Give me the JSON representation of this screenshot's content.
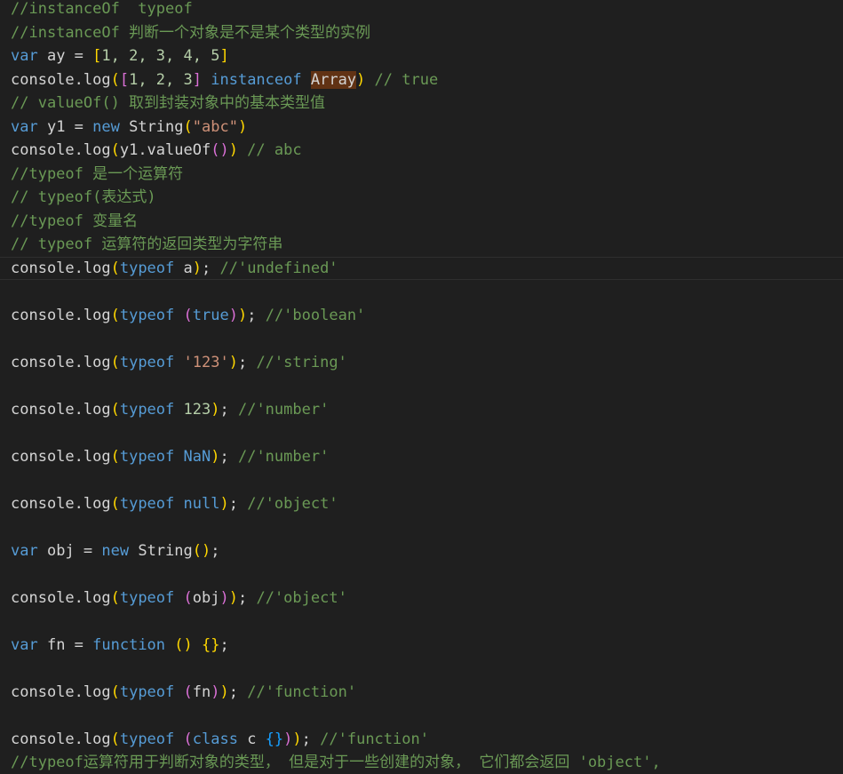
{
  "editor": {
    "colors": {
      "background": "#1f1f1f",
      "comment": "#6a9955",
      "keyword": "#569cd6",
      "string": "#ce9178",
      "number": "#b5cea8",
      "text": "#d4d4d4",
      "bracket_level1": "#ffd700",
      "bracket_level2": "#da70d6",
      "bracket_level3": "#179fff",
      "highlight": "#613214"
    },
    "lines": [
      {
        "tokens": [
          {
            "t": "//instanceOf  typeof",
            "c": "comment"
          }
        ]
      },
      {
        "tokens": [
          {
            "t": "//instanceOf 判断一个对象是不是某个类型的实例",
            "c": "comment"
          }
        ]
      },
      {
        "tokens": [
          {
            "t": "var",
            "c": "kw"
          },
          {
            "t": " ay = ",
            "c": "text"
          },
          {
            "t": "[",
            "c": "b1"
          },
          {
            "t": "1, 2, 3, 4, 5",
            "c": "num"
          },
          {
            "t": "]",
            "c": "b1"
          }
        ]
      },
      {
        "tokens": [
          {
            "t": "console.log",
            "c": "text"
          },
          {
            "t": "(",
            "c": "b1"
          },
          {
            "t": "[",
            "c": "b2"
          },
          {
            "t": "1, 2, 3",
            "c": "num"
          },
          {
            "t": "]",
            "c": "b2"
          },
          {
            "t": " ",
            "c": "text"
          },
          {
            "t": "instanceof",
            "c": "kw"
          },
          {
            "t": " ",
            "c": "text"
          },
          {
            "t": "Array",
            "c": "hl"
          },
          {
            "t": ")",
            "c": "b1"
          },
          {
            "t": " // true",
            "c": "comment"
          }
        ]
      },
      {
        "tokens": [
          {
            "t": "// valueOf() 取到封装对象中的基本类型值",
            "c": "comment"
          }
        ]
      },
      {
        "tokens": [
          {
            "t": "var",
            "c": "kw"
          },
          {
            "t": " y1 = ",
            "c": "text"
          },
          {
            "t": "new",
            "c": "kw"
          },
          {
            "t": " String",
            "c": "text"
          },
          {
            "t": "(",
            "c": "b1"
          },
          {
            "t": "\"abc\"",
            "c": "str"
          },
          {
            "t": ")",
            "c": "b1"
          }
        ]
      },
      {
        "tokens": [
          {
            "t": "console.log",
            "c": "text"
          },
          {
            "t": "(",
            "c": "b1"
          },
          {
            "t": "y1.valueOf",
            "c": "text"
          },
          {
            "t": "()",
            "c": "b2"
          },
          {
            "t": ")",
            "c": "b1"
          },
          {
            "t": " // abc",
            "c": "comment"
          }
        ]
      },
      {
        "tokens": [
          {
            "t": "//typeof 是一个运算符",
            "c": "comment"
          }
        ]
      },
      {
        "tokens": [
          {
            "t": "// typeof(表达式)",
            "c": "comment"
          }
        ]
      },
      {
        "tokens": [
          {
            "t": "//typeof 变量名",
            "c": "comment"
          }
        ]
      },
      {
        "tokens": [
          {
            "t": "// typeof 运算符的返回类型为字符串",
            "c": "comment"
          }
        ]
      },
      {
        "current": true,
        "tokens": [
          {
            "t": "console.log",
            "c": "text"
          },
          {
            "t": "(",
            "c": "b1"
          },
          {
            "t": "typeof",
            "c": "kw"
          },
          {
            "t": " a",
            "c": "text"
          },
          {
            "t": ")",
            "c": "b1"
          },
          {
            "t": "; ",
            "c": "text"
          },
          {
            "t": "//'undefined'",
            "c": "comment"
          }
        ]
      },
      {
        "tokens": []
      },
      {
        "tokens": [
          {
            "t": "console.log",
            "c": "text"
          },
          {
            "t": "(",
            "c": "b1"
          },
          {
            "t": "typeof",
            "c": "kw"
          },
          {
            "t": " ",
            "c": "text"
          },
          {
            "t": "(",
            "c": "b2"
          },
          {
            "t": "true",
            "c": "kw"
          },
          {
            "t": ")",
            "c": "b2"
          },
          {
            "t": ")",
            "c": "b1"
          },
          {
            "t": "; ",
            "c": "text"
          },
          {
            "t": "//'boolean'",
            "c": "comment"
          }
        ]
      },
      {
        "tokens": []
      },
      {
        "tokens": [
          {
            "t": "console.log",
            "c": "text"
          },
          {
            "t": "(",
            "c": "b1"
          },
          {
            "t": "typeof",
            "c": "kw"
          },
          {
            "t": " ",
            "c": "text"
          },
          {
            "t": "'123'",
            "c": "str"
          },
          {
            "t": ")",
            "c": "b1"
          },
          {
            "t": "; ",
            "c": "text"
          },
          {
            "t": "//'string'",
            "c": "comment"
          }
        ]
      },
      {
        "tokens": []
      },
      {
        "tokens": [
          {
            "t": "console.log",
            "c": "text"
          },
          {
            "t": "(",
            "c": "b1"
          },
          {
            "t": "typeof",
            "c": "kw"
          },
          {
            "t": " ",
            "c": "text"
          },
          {
            "t": "123",
            "c": "num"
          },
          {
            "t": ")",
            "c": "b1"
          },
          {
            "t": "; ",
            "c": "text"
          },
          {
            "t": "//'number'",
            "c": "comment"
          }
        ]
      },
      {
        "tokens": []
      },
      {
        "tokens": [
          {
            "t": "console.log",
            "c": "text"
          },
          {
            "t": "(",
            "c": "b1"
          },
          {
            "t": "typeof",
            "c": "kw"
          },
          {
            "t": " ",
            "c": "text"
          },
          {
            "t": "NaN",
            "c": "kw"
          },
          {
            "t": ")",
            "c": "b1"
          },
          {
            "t": "; ",
            "c": "text"
          },
          {
            "t": "//'number'",
            "c": "comment"
          }
        ]
      },
      {
        "tokens": []
      },
      {
        "tokens": [
          {
            "t": "console.log",
            "c": "text"
          },
          {
            "t": "(",
            "c": "b1"
          },
          {
            "t": "typeof",
            "c": "kw"
          },
          {
            "t": " ",
            "c": "text"
          },
          {
            "t": "null",
            "c": "kw"
          },
          {
            "t": ")",
            "c": "b1"
          },
          {
            "t": "; ",
            "c": "text"
          },
          {
            "t": "//'object'",
            "c": "comment"
          }
        ]
      },
      {
        "tokens": []
      },
      {
        "tokens": [
          {
            "t": "var",
            "c": "kw"
          },
          {
            "t": " obj = ",
            "c": "text"
          },
          {
            "t": "new",
            "c": "kw"
          },
          {
            "t": " String",
            "c": "text"
          },
          {
            "t": "()",
            "c": "b1"
          },
          {
            "t": ";",
            "c": "text"
          }
        ]
      },
      {
        "tokens": []
      },
      {
        "tokens": [
          {
            "t": "console.log",
            "c": "text"
          },
          {
            "t": "(",
            "c": "b1"
          },
          {
            "t": "typeof",
            "c": "kw"
          },
          {
            "t": " ",
            "c": "text"
          },
          {
            "t": "(",
            "c": "b2"
          },
          {
            "t": "obj",
            "c": "text"
          },
          {
            "t": ")",
            "c": "b2"
          },
          {
            "t": ")",
            "c": "b1"
          },
          {
            "t": "; ",
            "c": "text"
          },
          {
            "t": "//'object'",
            "c": "comment"
          }
        ]
      },
      {
        "tokens": []
      },
      {
        "tokens": [
          {
            "t": "var",
            "c": "kw"
          },
          {
            "t": " fn = ",
            "c": "text"
          },
          {
            "t": "function",
            "c": "kw"
          },
          {
            "t": " ",
            "c": "text"
          },
          {
            "t": "()",
            "c": "b1"
          },
          {
            "t": " ",
            "c": "text"
          },
          {
            "t": "{}",
            "c": "b1"
          },
          {
            "t": ";",
            "c": "text"
          }
        ]
      },
      {
        "tokens": []
      },
      {
        "tokens": [
          {
            "t": "console.log",
            "c": "text"
          },
          {
            "t": "(",
            "c": "b1"
          },
          {
            "t": "typeof",
            "c": "kw"
          },
          {
            "t": " ",
            "c": "text"
          },
          {
            "t": "(",
            "c": "b2"
          },
          {
            "t": "fn",
            "c": "text"
          },
          {
            "t": ")",
            "c": "b2"
          },
          {
            "t": ")",
            "c": "b1"
          },
          {
            "t": "; ",
            "c": "text"
          },
          {
            "t": "//'function'",
            "c": "comment"
          }
        ]
      },
      {
        "tokens": []
      },
      {
        "tokens": [
          {
            "t": "console.log",
            "c": "text"
          },
          {
            "t": "(",
            "c": "b1"
          },
          {
            "t": "typeof",
            "c": "kw"
          },
          {
            "t": " ",
            "c": "text"
          },
          {
            "t": "(",
            "c": "b2"
          },
          {
            "t": "class",
            "c": "kw"
          },
          {
            "t": " c ",
            "c": "text"
          },
          {
            "t": "{}",
            "c": "b3"
          },
          {
            "t": ")",
            "c": "b2"
          },
          {
            "t": ")",
            "c": "b1"
          },
          {
            "t": "; ",
            "c": "text"
          },
          {
            "t": "//'function'",
            "c": "comment"
          }
        ]
      },
      {
        "tokens": [
          {
            "t": "//typeof运算符用于判断对象的类型， 但是对于一些创建的对象， 它们都会返回 'object',",
            "c": "comment"
          }
        ]
      }
    ]
  }
}
